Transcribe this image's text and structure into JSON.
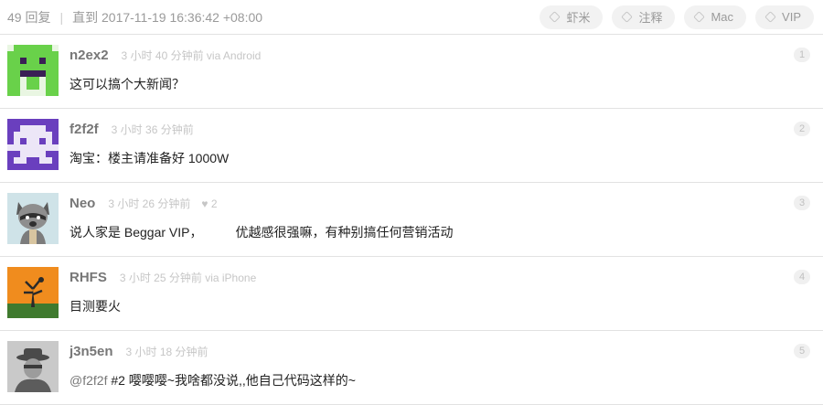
{
  "header": {
    "reply_count": "49 回复",
    "separator": "|",
    "until": "直到 2017-11-19 16:36:42 +08:00",
    "tags": [
      {
        "label": "虾米"
      },
      {
        "label": "注释"
      },
      {
        "label": "Mac"
      },
      {
        "label": "VIP"
      }
    ]
  },
  "replies": [
    {
      "username": "n2ex2",
      "meta": "3 小时 40 分钟前 via Android",
      "content": "这可以搞个大新闻？",
      "number": "1"
    },
    {
      "username": "f2f2f",
      "meta": "3 小时 36 分钟前",
      "content": "淘宝：楼主请准备好 1000W",
      "number": "2"
    },
    {
      "username": "Neo",
      "meta": "3 小时 26 分钟前",
      "likes": "♥ 2",
      "content_a": "说人家是 Beggar VIP，",
      "content_b": "优越感很强嘛，有种别搞任何营销活动",
      "number": "3"
    },
    {
      "username": "RHFS",
      "meta": "3 小时 25 分钟前 via iPhone",
      "content": "目测要火",
      "number": "4"
    },
    {
      "username": "j3n5en",
      "meta": "3 小时 18 分钟前",
      "mention": "@f2f2f",
      "content": " #2 嘤嘤嘤~我啥都没说,,他自己代码这样的~",
      "number": "5"
    }
  ],
  "icons": {
    "tag": "tag-icon",
    "heart": "heart-icon"
  },
  "colors": {
    "avatar_green": "#69d14a",
    "avatar_purple": "#6a3fbe",
    "avatar_orange": "#f08c1e",
    "avatar_gray": "#9c9c9c"
  }
}
